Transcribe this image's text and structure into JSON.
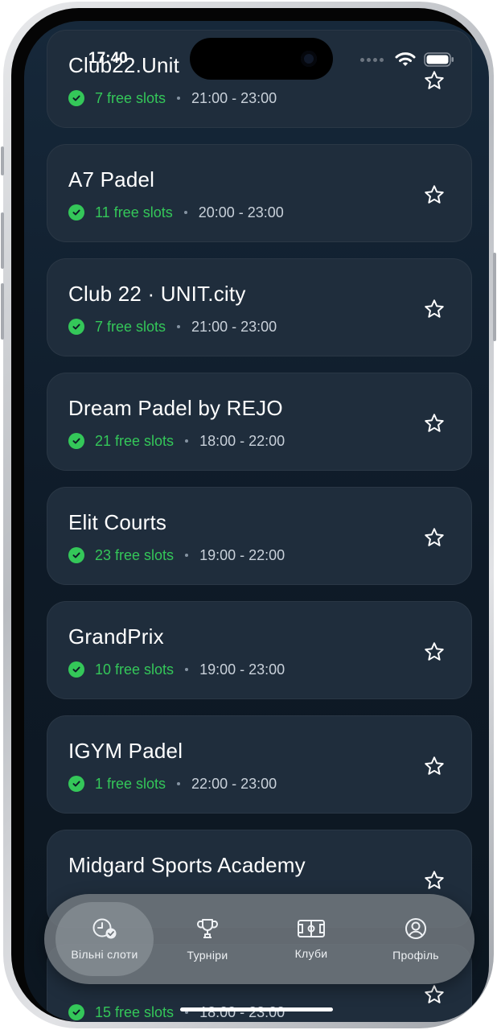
{
  "status_bar": {
    "time": "17:40"
  },
  "clubs": [
    {
      "name": "Club22.Unit",
      "slots": "7 free slots",
      "time": "21:00 - 23:00"
    },
    {
      "name": "A7 Padel",
      "slots": "11 free slots",
      "time": "20:00 - 23:00"
    },
    {
      "name": "Club 22 · UNIT.city",
      "slots": "7 free slots",
      "time": "21:00 - 23:00"
    },
    {
      "name": "Dream Padel by REJO",
      "slots": "21 free slots",
      "time": "18:00 - 22:00"
    },
    {
      "name": "Elit Courts",
      "slots": "23 free slots",
      "time": "19:00 - 22:00"
    },
    {
      "name": "GrandPrix",
      "slots": "10 free slots",
      "time": "19:00 - 23:00"
    },
    {
      "name": "IGYM Padel",
      "slots": "1 free slots",
      "time": "22:00 - 23:00"
    },
    {
      "name": "Midgard Sports Academy",
      "slots": "",
      "time": ""
    },
    {
      "name": "",
      "slots": "15 free slots",
      "time": "18:00 - 23:00"
    }
  ],
  "tabs": [
    {
      "label": "Вільні слоти",
      "icon": "clock-check-icon",
      "active": true
    },
    {
      "label": "Турніри",
      "icon": "trophy-icon",
      "active": false
    },
    {
      "label": "Клуби",
      "icon": "court-icon",
      "active": false
    },
    {
      "label": "Профіль",
      "icon": "profile-icon",
      "active": false
    }
  ],
  "colors": {
    "accent_green": "#34c759",
    "card_bg": "#1f2d3c",
    "screen_bg": "#0e1a27",
    "tabbar_bg": "#70767c"
  }
}
